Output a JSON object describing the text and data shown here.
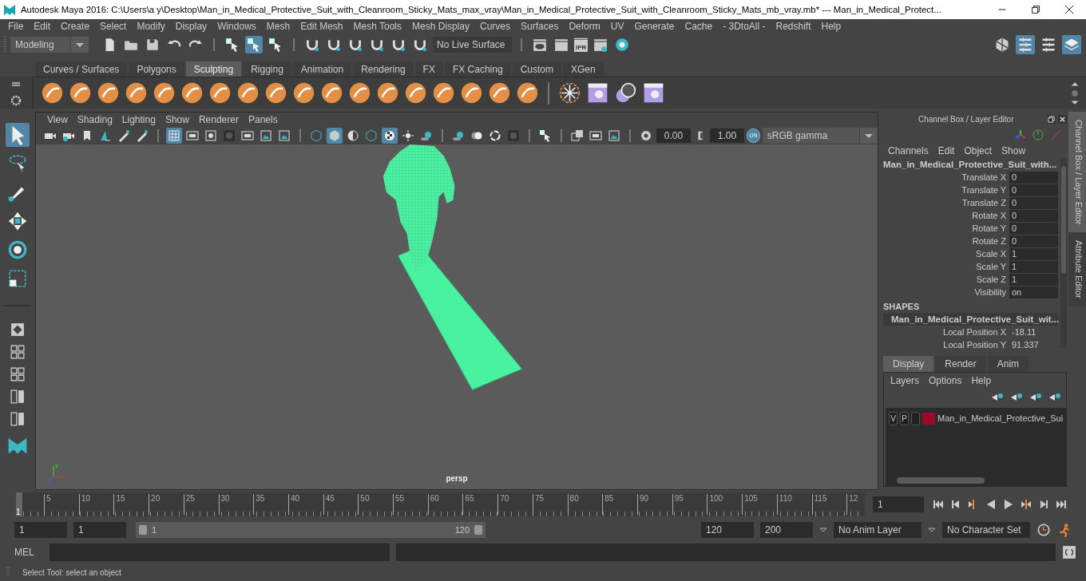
{
  "title_bar": {
    "title": "Autodesk Maya 2016: C:\\Users\\a y\\Desktop\\Man_in_Medical_Protective_Suit_with_Cleanroom_Sticky_Mats_max_vray\\Man_in_Medical_Protective_Suit_with_Cleanroom_Sticky_Mats_mb_vray.mb*  ---  Man_in_Medical_Protect..."
  },
  "menu_bar": [
    "File",
    "Edit",
    "Create",
    "Select",
    "Modify",
    "Display",
    "Windows",
    "Mesh",
    "Edit Mesh",
    "Mesh Tools",
    "Mesh Display",
    "Curves",
    "Surfaces",
    "Deform",
    "UV",
    "Generate",
    "Cache",
    "- 3DtoAll -",
    "Redshift",
    "Help"
  ],
  "status_line": {
    "mode": "Modeling",
    "tools": [
      {
        "kind": "file",
        "selected": false
      },
      {
        "kind": "folder",
        "selected": false
      },
      {
        "kind": "floppy",
        "selected": false
      },
      {
        "kind": "undo",
        "selected": false
      },
      {
        "kind": "redo",
        "selected": false
      },
      {
        "kind": "separator"
      },
      {
        "kind": "hierarchy-cursor",
        "selected": false
      },
      {
        "kind": "object-cursor",
        "selected": true
      },
      {
        "kind": "component-cursor",
        "selected": false
      },
      {
        "kind": "separator"
      },
      {
        "kind": "magnet",
        "selected": false
      },
      {
        "kind": "magnet",
        "selected": false
      },
      {
        "kind": "magnet",
        "selected": false
      },
      {
        "kind": "magnet",
        "selected": false
      },
      {
        "kind": "magnet",
        "selected": false
      },
      {
        "kind": "magnet",
        "selected": false
      }
    ],
    "live_surface": "No Live Surface",
    "render_tools": [
      {
        "kind": "clapper-eye"
      },
      {
        "kind": "clapper"
      },
      {
        "kind": "clapper",
        "label": "IPR"
      },
      {
        "kind": "clapper-gear"
      },
      {
        "kind": "disc"
      }
    ],
    "panel_tools": [
      {
        "kind": "cube-grid",
        "selected": false
      },
      {
        "kind": "panel-list",
        "selected": true
      },
      {
        "kind": "list",
        "selected": false
      },
      {
        "kind": "layers",
        "selected": true
      }
    ]
  },
  "shelf": {
    "tabs": [
      {
        "label": "Curves / Surfaces",
        "selected": false
      },
      {
        "label": "Polygons",
        "selected": false
      },
      {
        "label": "Sculpting",
        "selected": true
      },
      {
        "label": "Rigging",
        "selected": false
      },
      {
        "label": "Animation",
        "selected": false
      },
      {
        "label": "Rendering",
        "selected": false
      },
      {
        "label": "FX",
        "selected": false
      },
      {
        "label": "FX Caching",
        "selected": false
      },
      {
        "label": "Custom",
        "selected": false
      },
      {
        "label": "XGen",
        "selected": false
      }
    ],
    "tools": [
      {
        "kind": "sculpt-brush"
      },
      {
        "kind": "sculpt-brush"
      },
      {
        "kind": "sculpt-brush"
      },
      {
        "kind": "sculpt-brush"
      },
      {
        "kind": "sculpt-brush"
      },
      {
        "kind": "sculpt-brush"
      },
      {
        "kind": "sculpt-brush"
      },
      {
        "kind": "sculpt-brush"
      },
      {
        "kind": "sculpt-brush"
      },
      {
        "kind": "sculpt-brush"
      },
      {
        "kind": "sculpt-brush"
      },
      {
        "kind": "sculpt-brush"
      },
      {
        "kind": "sculpt-brush"
      },
      {
        "kind": "sculpt-brush"
      },
      {
        "kind": "sculpt-brush"
      },
      {
        "kind": "sculpt-brush"
      },
      {
        "kind": "sculpt-brush"
      },
      {
        "kind": "sculpt-brush"
      },
      {
        "kind": "separator"
      },
      {
        "kind": "snowflake"
      },
      {
        "kind": "shapes-window"
      },
      {
        "kind": "spheres"
      },
      {
        "kind": "shapes-window"
      }
    ]
  },
  "toolbox": [
    {
      "kind": "select-arrow",
      "selected": true
    },
    {
      "kind": "lasso",
      "selected": false
    },
    {
      "kind": "paint-select",
      "selected": false
    },
    {
      "kind": "move",
      "selected": false
    },
    {
      "kind": "rotate",
      "selected": false
    },
    {
      "kind": "scale",
      "selected": false
    },
    {
      "kind": "separator"
    },
    {
      "kind": "single-pane",
      "selected": false
    },
    {
      "kind": "four-pane",
      "selected": false
    },
    {
      "kind": "four-pane",
      "selected": false
    },
    {
      "kind": "split-pane",
      "selected": false
    },
    {
      "kind": "split-pane",
      "selected": false
    },
    {
      "kind": "logo",
      "selected": false
    }
  ],
  "viewport": {
    "menu": [
      "View",
      "Shading",
      "Lighting",
      "Show",
      "Renderer",
      "Panels"
    ],
    "tools": [
      {
        "kind": "camera",
        "selected": false
      },
      {
        "kind": "camera-gear",
        "selected": false
      },
      {
        "kind": "bookmark",
        "selected": false
      },
      {
        "kind": "image-plane",
        "selected": false
      },
      {
        "kind": "pivot",
        "selected": false
      },
      {
        "kind": "pen",
        "selected": false
      },
      {
        "kind": "separator"
      },
      {
        "kind": "grid",
        "selected": true
      },
      {
        "kind": "film-gate",
        "selected": false
      },
      {
        "kind": "circle-square",
        "selected": false
      },
      {
        "kind": "dark-square",
        "selected": false
      },
      {
        "kind": "dots-box",
        "selected": false
      },
      {
        "kind": "picture",
        "selected": false
      },
      {
        "kind": "text-box",
        "selected": false
      },
      {
        "kind": "separator"
      },
      {
        "kind": "wire-cube",
        "selected": false
      },
      {
        "kind": "shaded-cube",
        "selected": true
      },
      {
        "kind": "half-circle",
        "selected": false
      },
      {
        "kind": "wire-cube",
        "selected": false
      },
      {
        "kind": "checker",
        "selected": true
      },
      {
        "kind": "bulb",
        "selected": false
      },
      {
        "kind": "shadow-ball",
        "selected": false
      },
      {
        "kind": "separator"
      },
      {
        "kind": "shadow-ball",
        "selected": false
      },
      {
        "kind": "double-circle",
        "selected": false
      },
      {
        "kind": "ring",
        "selected": false
      },
      {
        "kind": "dark-square",
        "selected": false
      },
      {
        "kind": "separator"
      },
      {
        "kind": "box-cursor",
        "selected": false
      },
      {
        "kind": "separator"
      },
      {
        "kind": "stacked-squares",
        "selected": false
      },
      {
        "kind": "frame-square",
        "selected": false
      },
      {
        "kind": "picture",
        "selected": false
      },
      {
        "kind": "separator"
      },
      {
        "kind": "aperture",
        "selected": false
      }
    ],
    "exposure": "0.00",
    "gamma": "1.00",
    "color_management": "ON",
    "color_space": "sRGB gamma",
    "camera": "persp",
    "axis": {
      "x": "x",
      "y": "y",
      "z": "z"
    }
  },
  "channel_box": {
    "title": "Channel Box / Layer Editor",
    "menu": [
      "Channels",
      "Edit",
      "Object",
      "Show"
    ],
    "object": "Man_in_Medical_Protective_Suit_with...",
    "channels": [
      {
        "name": "Translate X",
        "value": "0"
      },
      {
        "name": "Translate Y",
        "value": "0"
      },
      {
        "name": "Translate Z",
        "value": "0"
      },
      {
        "name": "Rotate X",
        "value": "0"
      },
      {
        "name": "Rotate Y",
        "value": "0"
      },
      {
        "name": "Rotate Z",
        "value": "0"
      },
      {
        "name": "Scale X",
        "value": "1"
      },
      {
        "name": "Scale Y",
        "value": "1"
      },
      {
        "name": "Scale Z",
        "value": "1"
      },
      {
        "name": "Visibility",
        "value": "on"
      }
    ],
    "shapes_heading": "SHAPES",
    "shape": "Man_in_Medical_Protective_Suit_wit...",
    "shape_channels": [
      {
        "name": "Local Position X",
        "value": "-18.11"
      },
      {
        "name": "Local Position Y",
        "value": "91.337"
      }
    ]
  },
  "layer_editor": {
    "tabs": [
      {
        "label": "Display",
        "selected": true
      },
      {
        "label": "Render",
        "selected": false
      },
      {
        "label": "Anim",
        "selected": false
      }
    ],
    "menu": [
      "Layers",
      "Options",
      "Help"
    ],
    "layers": [
      {
        "visible": "V",
        "playback": "P",
        "color": "#9b0a2c",
        "name": "Man_in_Medical_Protective_Sui"
      }
    ]
  },
  "side_tabs": [
    {
      "label": "Channel Box / Layer Editor",
      "selected": true
    },
    {
      "label": "Attribute Editor",
      "selected": false
    }
  ],
  "timeline": {
    "ticks": [
      "5",
      "10",
      "15",
      "20",
      "25",
      "30",
      "35",
      "40",
      "45",
      "50",
      "55",
      "60",
      "65",
      "70",
      "75",
      "80",
      "85",
      "90",
      "95",
      "100",
      "105",
      "110",
      "115",
      "12"
    ],
    "current_frame": "1",
    "frame_field": "1",
    "controls": [
      {
        "kind": "skip-start"
      },
      {
        "kind": "step-back"
      },
      {
        "kind": "prev-key"
      },
      {
        "kind": "play-back"
      },
      {
        "kind": "play"
      },
      {
        "kind": "next-key"
      },
      {
        "kind": "step-forward"
      },
      {
        "kind": "skip-end"
      }
    ]
  },
  "range": {
    "start": "1",
    "playback_start": "1",
    "slider_start": "1",
    "slider_end": "120",
    "playback_end": "120",
    "end": "200",
    "anim_layer": "No Anim Layer",
    "character_set": "No Character Set"
  },
  "command_line": {
    "label": "MEL"
  },
  "help_line": "Select Tool: select an object"
}
